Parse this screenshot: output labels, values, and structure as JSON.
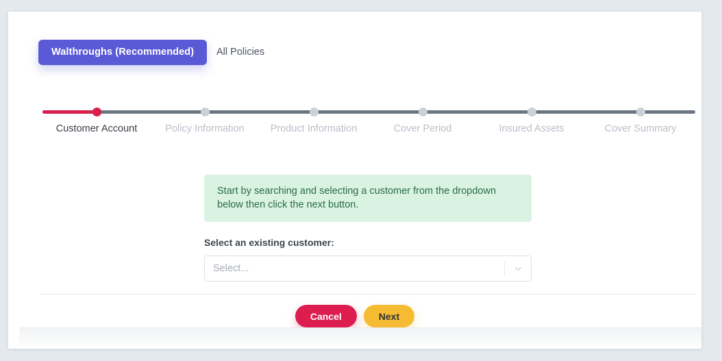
{
  "tabs": [
    {
      "label": "Walthroughs (Recommended)",
      "active": true,
      "name": "tab-walkthroughs"
    },
    {
      "label": "All Policies",
      "active": false,
      "name": "tab-all-policies"
    }
  ],
  "stepper": {
    "active_index": 0,
    "progress_percent": 9,
    "active_color": "#d81e4a",
    "track_color": "#6b7584",
    "inactive_dot_color": "#ccd1d9",
    "steps": [
      {
        "label": "Customer Account"
      },
      {
        "label": "Policy Information"
      },
      {
        "label": "Product Information"
      },
      {
        "label": "Cover Period"
      },
      {
        "label": "Insured Assets"
      },
      {
        "label": "Cover Summary"
      }
    ]
  },
  "info_box": {
    "text": "Start by searching and selecting a customer from the dropdown below then click the next button.",
    "background": "#d9f2e2",
    "text_color": "#2b6b48"
  },
  "form": {
    "field_label": "Select an existing customer:",
    "select_placeholder": "Select...",
    "select_value": "",
    "chevron_icon": "chevron-down-icon"
  },
  "footer": {
    "cancel_label": "Cancel",
    "cancel_color": "#dd1d4f",
    "next_label": "Next",
    "next_color": "#f5bb32"
  },
  "colors": {
    "page_background": "#e4e9ee",
    "card_background": "#ffffff",
    "tab_active": "#5a5ad6"
  }
}
